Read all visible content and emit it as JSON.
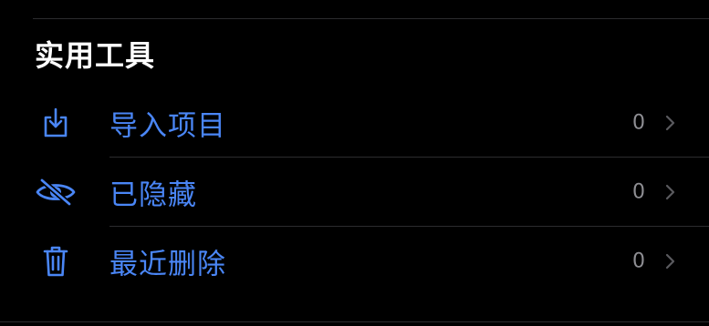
{
  "section": {
    "title": "实用工具"
  },
  "colors": {
    "accent": "#4a86f6",
    "secondary_text": "#8e8e93",
    "background": "#000000",
    "divider": "#2c2c2e"
  },
  "rows": [
    {
      "icon": "import-tray-icon",
      "label": "导入项目",
      "count": "0"
    },
    {
      "icon": "eye-slash-icon",
      "label": "已隐藏",
      "count": "0"
    },
    {
      "icon": "trash-icon",
      "label": "最近删除",
      "count": "0"
    }
  ]
}
